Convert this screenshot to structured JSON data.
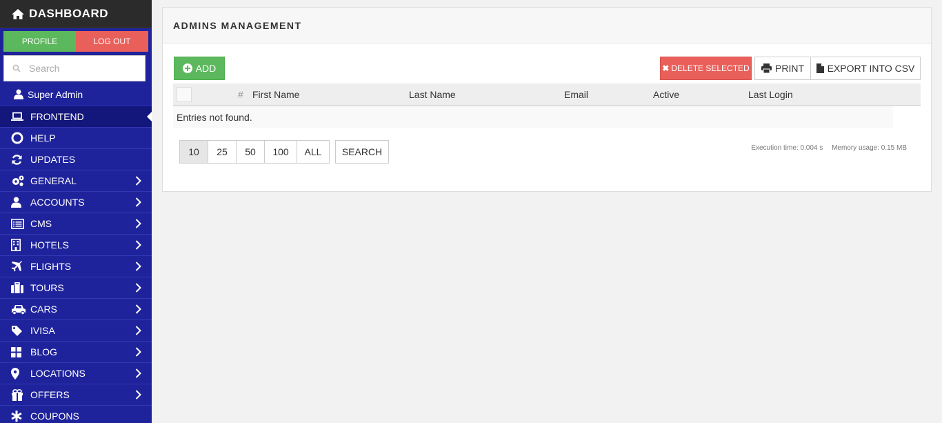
{
  "brand": {
    "title": "DASHBOARD",
    "icon": "home-icon"
  },
  "auth": {
    "profile": "PROFILE",
    "logout": "LOG OUT"
  },
  "search": {
    "placeholder": "Search"
  },
  "user": {
    "name": "Super Admin"
  },
  "menu": [
    {
      "label": "FRONTEND",
      "icon": "laptop-icon",
      "active": true
    },
    {
      "label": "HELP",
      "icon": "lifebuoy-icon"
    },
    {
      "label": "UPDATES",
      "icon": "refresh-icon"
    },
    {
      "label": "GENERAL",
      "icon": "gears-icon",
      "chevron": true
    },
    {
      "label": "ACCOUNTS",
      "icon": "user-icon",
      "chevron": true
    },
    {
      "label": "CMS",
      "icon": "list-alt-icon",
      "chevron": true
    },
    {
      "label": "HOTELS",
      "icon": "building-icon",
      "chevron": true
    },
    {
      "label": "FLIGHTS",
      "icon": "plane-icon",
      "chevron": true
    },
    {
      "label": "TOURS",
      "icon": "suitcase-icon",
      "chevron": true
    },
    {
      "label": "CARS",
      "icon": "car-icon",
      "chevron": true
    },
    {
      "label": "IVISA",
      "icon": "tag-icon",
      "chevron": true
    },
    {
      "label": "BLOG",
      "icon": "th-large-icon",
      "chevron": true
    },
    {
      "label": "LOCATIONS",
      "icon": "map-marker-icon",
      "chevron": true
    },
    {
      "label": "OFFERS",
      "icon": "gift-icon",
      "chevron": true
    },
    {
      "label": "COUPONS",
      "icon": "asterisk-icon"
    }
  ],
  "panel": {
    "title": "ADMINS MANAGEMENT",
    "add": "ADD",
    "delete_selected": "DELETE SELECTED",
    "print": "PRINT",
    "export_csv": "EXPORT INTO CSV",
    "columns": {
      "hash": "#",
      "first_name": "First Name",
      "last_name": "Last Name",
      "email": "Email",
      "active": "Active",
      "last_login": "Last Login"
    },
    "empty": "Entries not found.",
    "page_sizes": [
      "10",
      "25",
      "50",
      "100",
      "ALL"
    ],
    "selected_page_size": "10",
    "search": "SEARCH",
    "execution_time": "Execution time: 0.004 s",
    "memory_usage": "Memory usage: 0.15 MB"
  },
  "colors": {
    "sidebar": "#1f239b",
    "success": "#5cb85c",
    "danger": "#e9605b"
  }
}
